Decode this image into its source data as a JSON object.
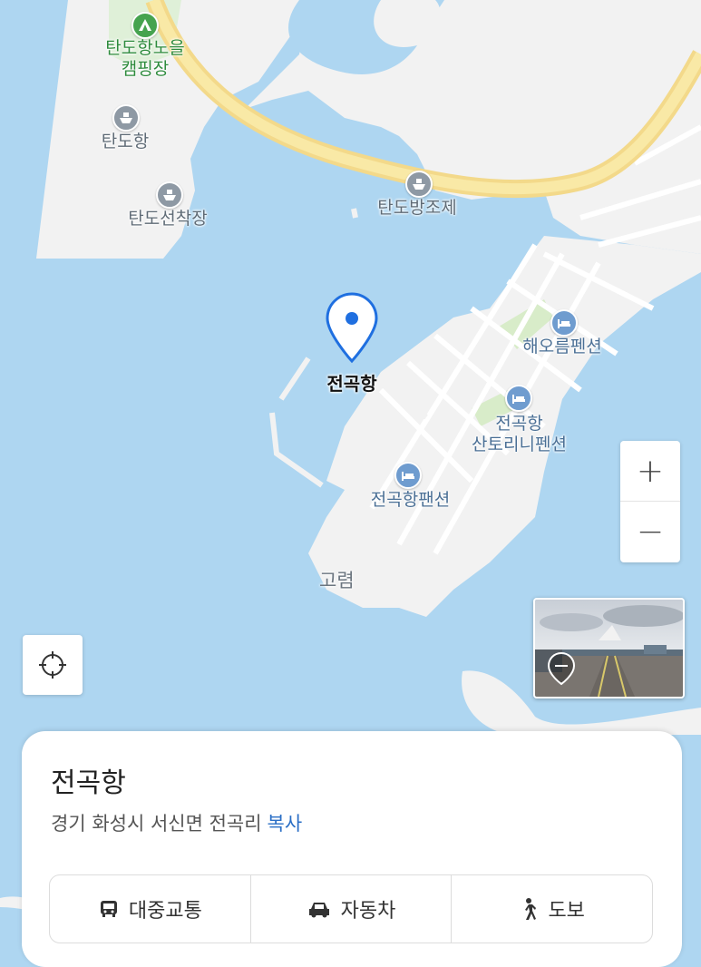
{
  "map": {
    "pin_label": "전곡항",
    "area_label": "고렴",
    "pois": [
      {
        "id": "campsite",
        "label_lines": [
          "탄도항노을",
          "캠핑장"
        ],
        "icon": "tent-icon",
        "color": "green"
      },
      {
        "id": "tandohang",
        "label_lines": [
          "탄도항"
        ],
        "icon": "ship-icon",
        "color": "gray"
      },
      {
        "id": "tando_pier",
        "label_lines": [
          "탄도선착장"
        ],
        "icon": "ship-icon",
        "color": "gray"
      },
      {
        "id": "tando_dike",
        "label_lines": [
          "탄도방조제"
        ],
        "icon": "ship-icon",
        "color": "gray"
      },
      {
        "id": "haeoreum",
        "label_lines": [
          "해오름펜션"
        ],
        "icon": "bed-icon",
        "color": "blue"
      },
      {
        "id": "santorini",
        "label_lines": [
          "전곡항",
          "산토리니펜션"
        ],
        "icon": "bed-icon",
        "color": "blue"
      },
      {
        "id": "jeongok_pension",
        "label_lines": [
          "전곡항팬션"
        ],
        "icon": "bed-icon",
        "color": "blue"
      }
    ],
    "controls": {
      "zoom_in": "+",
      "zoom_out": "−"
    }
  },
  "place_card": {
    "title": "전곡항",
    "address": "경기 화성시 서신면 전곡리",
    "copy_label": "복사",
    "actions": [
      {
        "label": "대중교통",
        "icon": "bus-icon"
      },
      {
        "label": "자동차",
        "icon": "car-icon"
      },
      {
        "label": "도보",
        "icon": "walk-icon"
      }
    ]
  }
}
